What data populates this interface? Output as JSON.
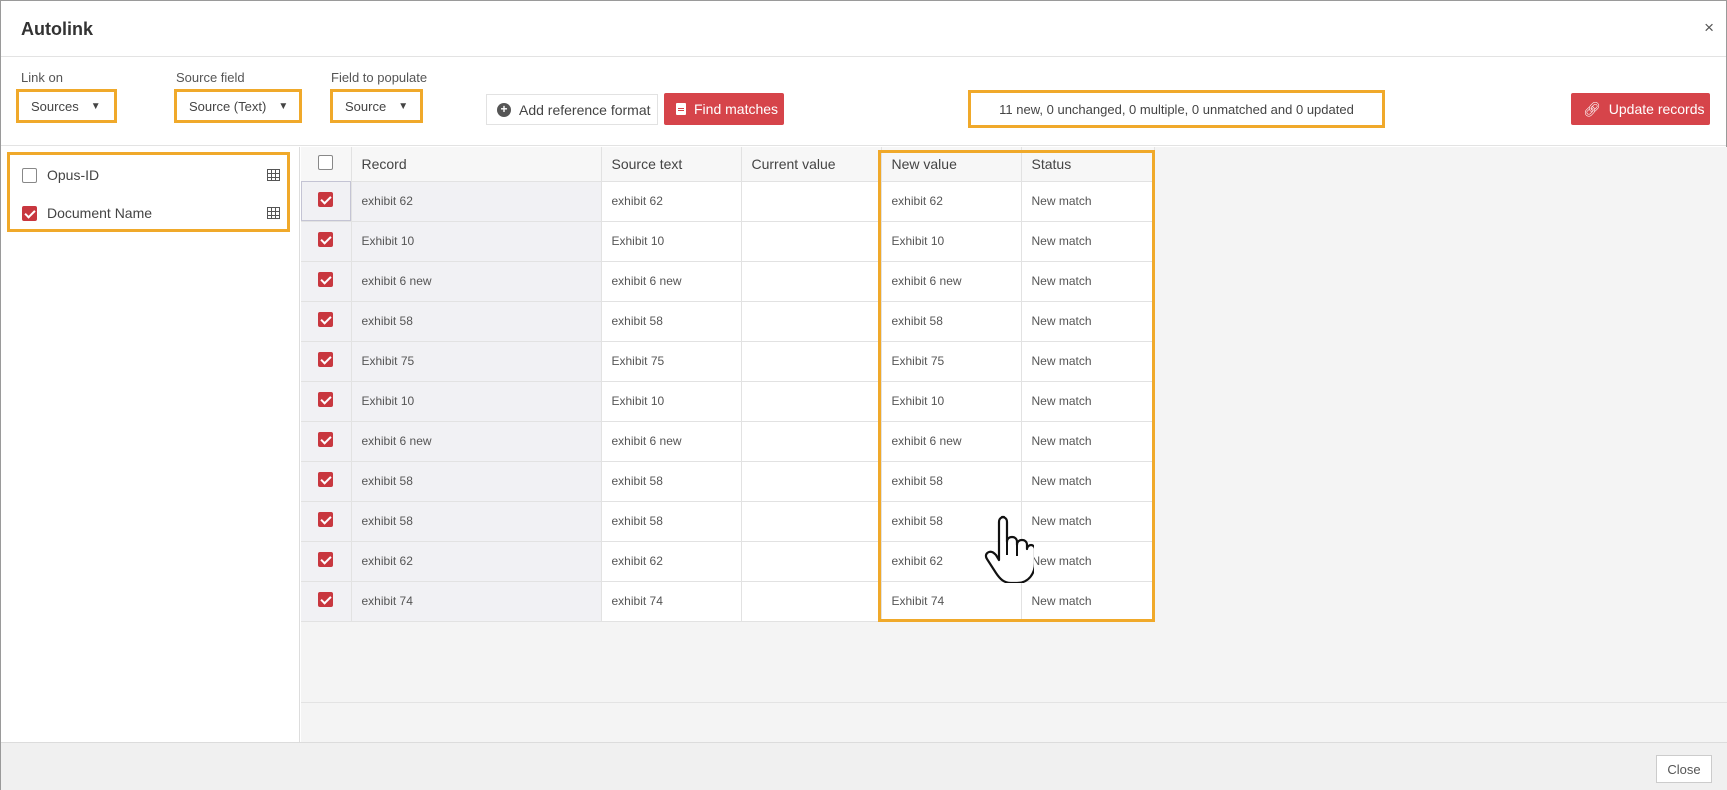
{
  "dialog": {
    "title": "Autolink",
    "close_icon": "×"
  },
  "toolbar": {
    "link_on": {
      "label": "Link on",
      "value": "Sources"
    },
    "source_field": {
      "label": "Source field",
      "value": "Source (Text)"
    },
    "field_to_populate": {
      "label": "Field to populate",
      "value": "Source"
    },
    "add_reference_format": "Add reference format",
    "find_matches": "Find matches",
    "summary": "11 new, 0 unchanged, 0 multiple, 0 unmatched and 0 updated",
    "update_records": "Update records"
  },
  "fields": [
    {
      "label": "Opus-ID",
      "checked": false,
      "icon": "grid-icon"
    },
    {
      "label": "Document Name",
      "checked": true,
      "icon": "grid-icon"
    }
  ],
  "table": {
    "headers": [
      "Record",
      "Source text",
      "Current value",
      "New value",
      "Status"
    ],
    "rows": [
      {
        "record": "exhibit 62",
        "source_text": "exhibit 62",
        "current_value": "",
        "new_value": "exhibit 62",
        "status": "New match"
      },
      {
        "record": "Exhibit 10",
        "source_text": "Exhibit 10",
        "current_value": "",
        "new_value": "Exhibit 10",
        "status": "New match"
      },
      {
        "record": "exhibit 6 new",
        "source_text": "exhibit 6 new",
        "current_value": "",
        "new_value": "exhibit 6 new",
        "status": "New match"
      },
      {
        "record": "exhibit 58",
        "source_text": "exhibit 58",
        "current_value": "",
        "new_value": "exhibit 58",
        "status": "New match"
      },
      {
        "record": "Exhibit 75",
        "source_text": "Exhibit 75",
        "current_value": "",
        "new_value": "Exhibit 75",
        "status": "New match"
      },
      {
        "record": "Exhibit 10",
        "source_text": "Exhibit 10",
        "current_value": "",
        "new_value": "Exhibit 10",
        "status": "New match"
      },
      {
        "record": "exhibit 6 new",
        "source_text": "exhibit 6 new",
        "current_value": "",
        "new_value": "exhibit 6 new",
        "status": "New match"
      },
      {
        "record": "exhibit 58",
        "source_text": "exhibit 58",
        "current_value": "",
        "new_value": "exhibit 58",
        "status": "New match"
      },
      {
        "record": "exhibit 58",
        "source_text": "exhibit 58",
        "current_value": "",
        "new_value": "exhibit 58",
        "status": "New match"
      },
      {
        "record": "exhibit 62",
        "source_text": "exhibit 62",
        "current_value": "",
        "new_value": "exhibit 62",
        "status": "New match"
      },
      {
        "record": "exhibit 74",
        "source_text": "exhibit 74",
        "current_value": "",
        "new_value": "Exhibit 74",
        "status": "New match"
      }
    ]
  },
  "footer": {
    "close": "Close"
  },
  "colors": {
    "accent": "#d6444a",
    "highlight": "#f0a92a",
    "checkbox": "#c8373f"
  }
}
